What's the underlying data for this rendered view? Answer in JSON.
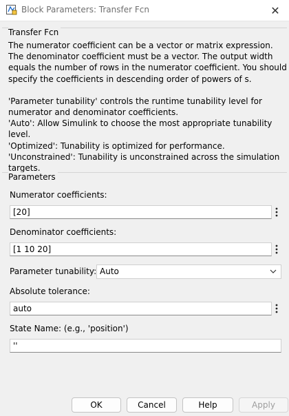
{
  "window": {
    "title": "Block Parameters: Transfer Fcn",
    "close_glyph": "✕"
  },
  "description": {
    "group_label": "Transfer Fcn",
    "paragraph1": "The numerator coefficient can be a vector or matrix expression. The denominator coefficient must be a vector. The output width equals the number of rows in the numerator coefficient. You should specify the coefficients in descending order of powers of s.",
    "tunability_lines": [
      "'Parameter tunability' controls the runtime tunability level for numerator and denominator coefficients.",
      "'Auto': Allow Simulink to choose the most appropriate tunability level.",
      "'Optimized': Tunability is optimized for performance.",
      "'Unconstrained': Tunability is unconstrained across the simulation targets."
    ]
  },
  "parameters": {
    "group_label": "Parameters",
    "numerator": {
      "label": "Numerator coefficients:",
      "value": "[20]"
    },
    "denominator": {
      "label": "Denominator coefficients:",
      "value": "[1 10 20]"
    },
    "tunability": {
      "label": "Parameter tunability:",
      "value": "Auto"
    },
    "abs_tol": {
      "label": "Absolute tolerance:",
      "value": "auto"
    },
    "state_name": {
      "label": "State Name: (e.g., 'position')",
      "value": "''"
    }
  },
  "buttons": {
    "ok": "OK",
    "cancel": "Cancel",
    "help": "Help",
    "apply": "Apply",
    "apply_enabled": false
  },
  "icons": {
    "title_icon": "simulink-block-icon",
    "more_options": "vertical-ellipsis-icon",
    "dropdown": "chevron-down-icon"
  }
}
